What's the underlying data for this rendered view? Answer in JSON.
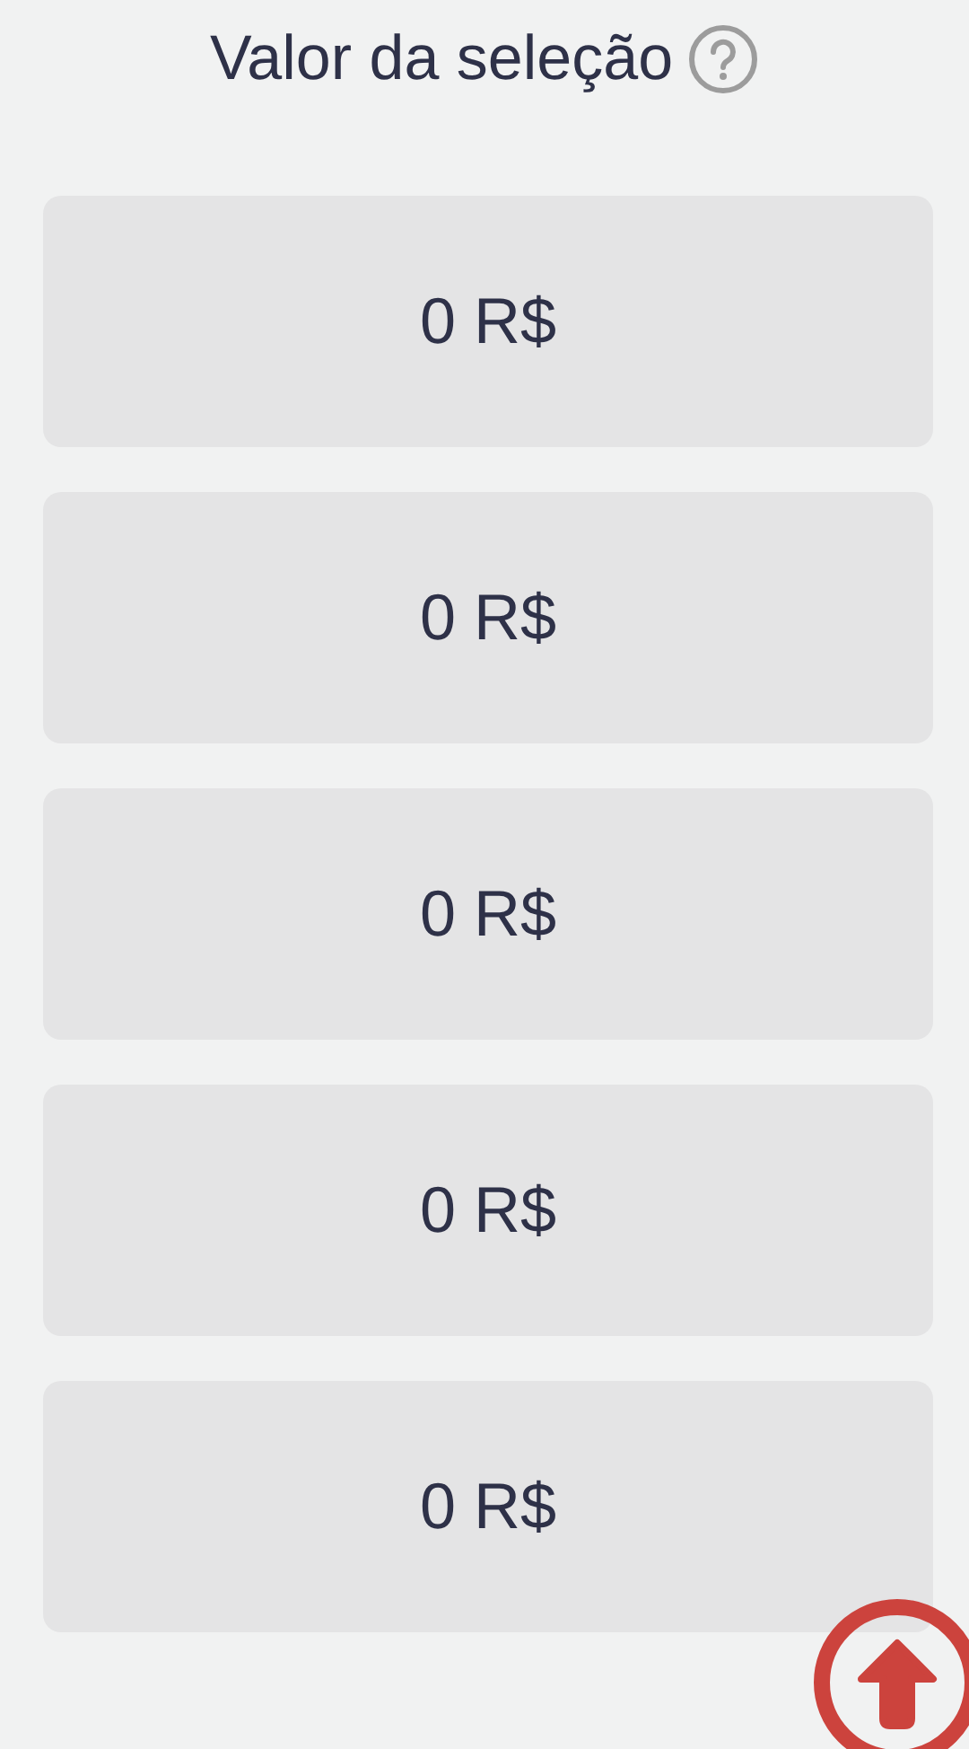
{
  "title": "Valor da seleção",
  "values": [
    "0 R$",
    "0 R$",
    "0 R$",
    "0 R$",
    "0 R$"
  ]
}
